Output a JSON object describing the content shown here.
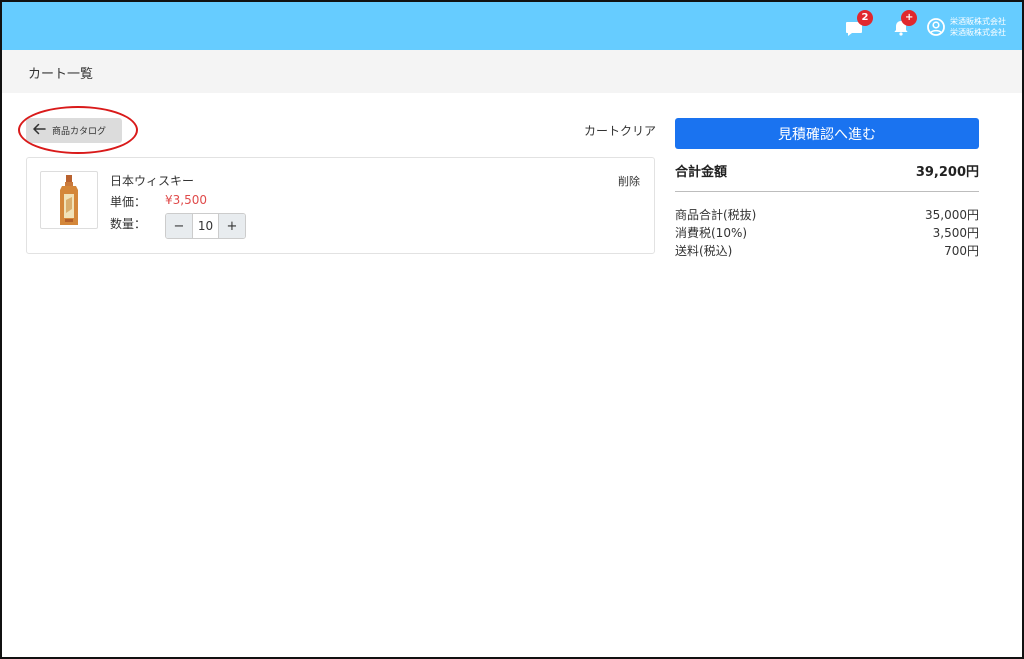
{
  "header": {
    "chat_badge": "2",
    "notification_badge": "+",
    "company_line1": "栄酒販株式会社",
    "company_line2": "栄酒販株式会社",
    "bg_color": "#66ccff"
  },
  "page": {
    "title": "カート一覧"
  },
  "nav": {
    "back_label": "商品カタログ",
    "cart_clear_label": "カートクリア"
  },
  "cart": {
    "items": [
      {
        "name": "日本ウィスキー",
        "unit_label": "単価：",
        "unit_price": "¥3,500",
        "qty_label": "数量：",
        "qty": "10",
        "minus": "−",
        "plus": "+",
        "delete_label": "削除"
      }
    ]
  },
  "summary": {
    "proceed_label": "見積確認へ進む",
    "total_label": "合計金額",
    "total_value": "39,200円",
    "rows": [
      {
        "label": "商品合計(税抜)",
        "value": "35,000円"
      },
      {
        "label": "消費税(10%)",
        "value": "3,500円"
      },
      {
        "label": "送料(税込)",
        "value": "700円"
      }
    ],
    "accent_color": "#1a73f0",
    "price_color": "#e04b4b"
  }
}
